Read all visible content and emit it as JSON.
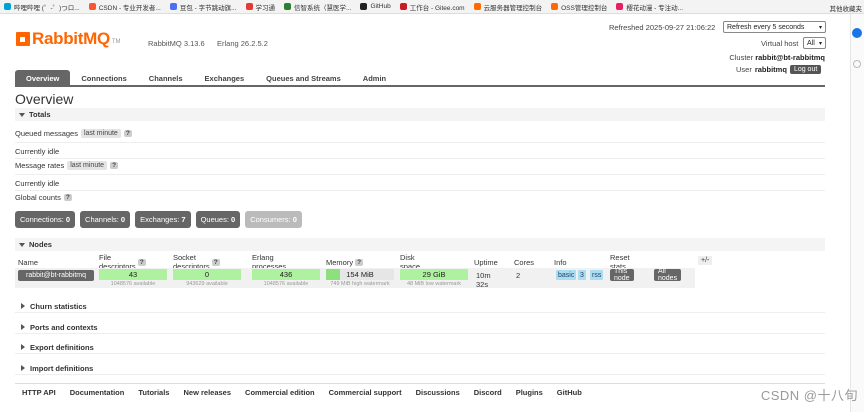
{
  "bookmarks": [
    {
      "label": "哔哩哔哩 (゜-゜)つロ...",
      "color": "#00a1d6"
    },
    {
      "label": "CSDN - 专业开发者...",
      "color": "#fc5531"
    },
    {
      "label": "豆包 - 字节跳动旗...",
      "color": "#4e6ef2"
    },
    {
      "label": "学习通",
      "color": "#e53935"
    },
    {
      "label": "信智系统（慧医学...",
      "color": "#2e7d32"
    },
    {
      "label": "GitHub",
      "color": "#222222"
    },
    {
      "label": "工作台 - Gitee.com",
      "color": "#c71d23"
    },
    {
      "label": "云服务器管理控制台",
      "color": "#ff6a00"
    },
    {
      "label": "OSS管理控制台",
      "color": "#ff6a00"
    },
    {
      "label": "樱花动漫 - 专注动...",
      "color": "#e91e63"
    }
  ],
  "bookmarks_right": "其他收藏夹",
  "header": {
    "logo_text": "RabbitMQ",
    "logo_tm": "TM",
    "rabbitmq_version": "RabbitMQ 3.13.6",
    "erlang_version": "Erlang 26.2.5.2",
    "refreshed": "Refreshed 2025-09-27 21:06:22",
    "refresh_select": "Refresh every 5 seconds",
    "vhost_label": "Virtual host",
    "vhost_select": "All",
    "cluster_label": "Cluster",
    "cluster_name": "rabbit@bt-rabbitmq",
    "user_label": "User",
    "user_name": "rabbitmq",
    "logout": "Log out"
  },
  "nav": [
    "Overview",
    "Connections",
    "Channels",
    "Exchanges",
    "Queues and Streams",
    "Admin"
  ],
  "page_title": "Overview",
  "totals": {
    "title": "Totals",
    "queued_messages": "Queued messages",
    "queued_chip": "last minute",
    "q": "?",
    "currently_idle_1": "Currently idle",
    "message_rates": "Message rates",
    "rates_chip": "last minute",
    "currently_idle_2": "Currently idle",
    "global_counts": "Global counts"
  },
  "counts": [
    {
      "label": "Connections:",
      "value": "0",
      "disabled": false
    },
    {
      "label": "Channels:",
      "value": "0",
      "disabled": false
    },
    {
      "label": "Exchanges:",
      "value": "7",
      "disabled": false
    },
    {
      "label": "Queues:",
      "value": "0",
      "disabled": false
    },
    {
      "label": "Consumers:",
      "value": "0",
      "disabled": true
    }
  ],
  "nodes": {
    "title": "Nodes",
    "headers": [
      "Name",
      "File descriptors",
      "Socket descriptors",
      "Erlang processes",
      "Memory",
      "Disk space",
      "Uptime",
      "Cores",
      "Info",
      "Reset stats"
    ],
    "plus_minus": "+/-",
    "row": {
      "name": "rabbit@bt-rabbitmq",
      "file_descriptors": "43",
      "fd_available": "1048576 available",
      "socket_descriptors": "0",
      "sd_available": "943629 available",
      "erlang_processes": "436",
      "ep_available": "1048576 available",
      "memory": "154 MiB",
      "memory_fraction": 0.21,
      "memory_watermark": "749 MiB high watermark",
      "disk_space": "29 GiB",
      "disk_watermark": "48 MiB low watermark",
      "uptime": "10m 32s",
      "cores": "2",
      "info_tags": [
        "basic",
        "3",
        "rss"
      ],
      "this_node": "This node",
      "all_nodes": "All nodes"
    }
  },
  "sections": [
    "Churn statistics",
    "Ports and contexts",
    "Export definitions",
    "Import definitions"
  ],
  "footer": [
    "HTTP API",
    "Documentation",
    "Tutorials",
    "New releases",
    "Commercial edition",
    "Commercial support",
    "Discussions",
    "Discord",
    "Plugins",
    "GitHub"
  ],
  "watermark": "CSDN @十八旬"
}
